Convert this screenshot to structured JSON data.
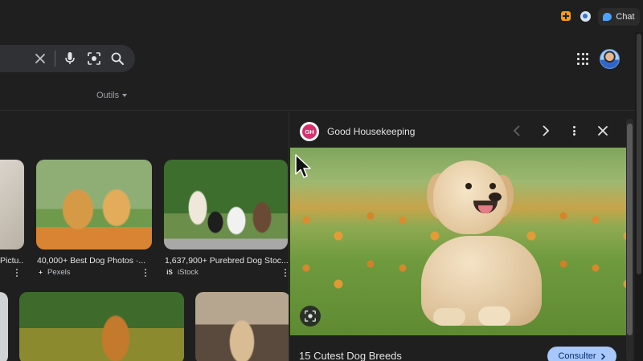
{
  "browser": {
    "chat_label": "Chat",
    "extensions": [
      "orange-extension-icon",
      "blue-extension-icon"
    ]
  },
  "search": {
    "icons": [
      "close-icon",
      "mic-icon",
      "lens-icon",
      "search-icon"
    ]
  },
  "toolbar": {
    "tools_label": "Outils"
  },
  "results": [
    {
      "caption": "Pictu...",
      "source": "",
      "partial": true
    },
    {
      "caption": "40,000+ Best Dog Photos ·...",
      "source": "Pexels",
      "source_logo": "+"
    },
    {
      "caption": "1,637,900+ Purebred Dog Stoc...",
      "source": "iStock",
      "source_logo": "iS"
    }
  ],
  "panel": {
    "site_name": "Good Housekeeping",
    "logo_text": "GH",
    "result_title": "15 Cutest Dog Breeds",
    "visit_label": "Consulter",
    "colors": {
      "logo": "#d6306e",
      "visit_button": "#a8c7fa"
    }
  },
  "theme": {
    "background": "#1f1f1f",
    "surface": "#303134",
    "text": "#e3e3e3"
  }
}
